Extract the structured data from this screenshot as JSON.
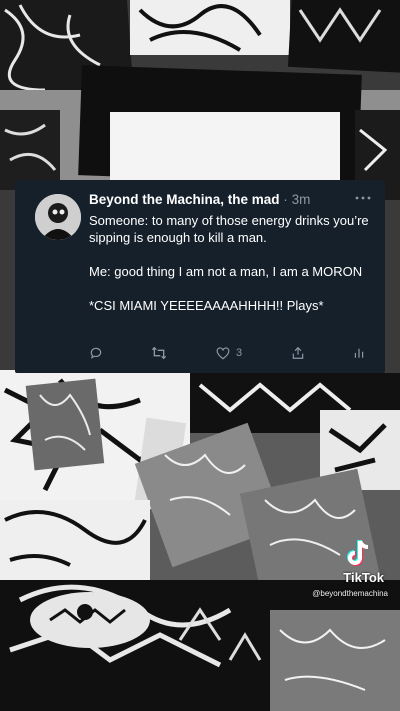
{
  "tweet": {
    "display_name": "Beyond the Machina, the mad",
    "separator": "·",
    "time": "3m",
    "more_icon": "more-horizontal-icon",
    "lines": [
      "Someone: to many of those energy drinks you’re sipping is enough to kill a man.",
      "Me: good thing I am not a man, I am a MORON",
      "*CSI MIAMI YEEEEAAAAHHHH!! Plays*"
    ],
    "actions": {
      "reply_icon": "reply-icon",
      "retweet_icon": "retweet-icon",
      "like_icon": "like-icon",
      "like_count": "3",
      "share_icon": "share-icon",
      "analytics_icon": "analytics-icon"
    },
    "colors": {
      "card": "#15202b",
      "text": "#ffffff",
      "muted": "#8b98a5"
    }
  },
  "watermark": {
    "brand": "TikTok",
    "handle": "@beyondthemachina"
  }
}
